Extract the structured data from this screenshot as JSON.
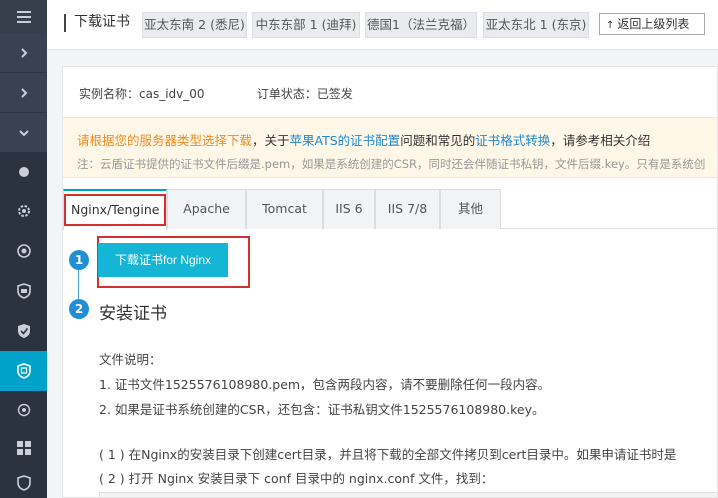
{
  "sidebar": {
    "items": [
      {
        "icon": "hamburger-icon"
      },
      {
        "icon": "chevron-right-icon"
      },
      {
        "icon": "chevron-right-icon"
      },
      {
        "icon": "chevron-down-icon"
      },
      {
        "icon": "dot-icon"
      },
      {
        "icon": "gear-icon"
      },
      {
        "icon": "eye-icon"
      },
      {
        "icon": "shield-icon"
      },
      {
        "icon": "shield-check-icon"
      },
      {
        "icon": "certificate-icon",
        "active": true
      },
      {
        "icon": "target-icon"
      },
      {
        "icon": "windows-icon"
      },
      {
        "icon": "shield-lock-icon"
      }
    ],
    "active_color": "#00a2ca"
  },
  "header": {
    "title": "下载证书",
    "regions": [
      "亚太东南 2 (悉尼)",
      "中东东部 1 (迪拜)",
      "德国1（法兰克福）",
      "亚太东北 1 (东京)"
    ],
    "back_label": "返回上级列表"
  },
  "instance": {
    "name_label": "实例名称：cas_idv_00",
    "status_label": "订单状态：已签发"
  },
  "notice": {
    "line1_a": "请根据您的服务器类型选择下载",
    "line1_b": "，关于",
    "link1": "苹果ATS的证书配置",
    "line1_c": "问题和常见的",
    "link2": "证书格式转换",
    "line1_d": "，请参考相关介绍",
    "line2": "注：云盾证书提供的证书文件后缀是.pem，如果是系统创建的CSR，同时还会伴随证书私钥，文件后缀.key。只有是系统创"
  },
  "tabs": [
    "Nginx/Tengine",
    "Apache",
    "Tomcat",
    "IIS 6",
    "IIS 7/8",
    "其他"
  ],
  "steps": {
    "step1_num": "1",
    "download_button": "下载证书for Nginx",
    "step2_num": "2",
    "step2_title": "安装证书"
  },
  "doc": {
    "heading": "文件说明：",
    "line1": "1. 证书文件1525576108980.pem，包含两段内容，请不要删除任何一段内容。",
    "line2": "2. 如果是证书系统创建的CSR，还包含：证书私钥文件1525576108980.key。",
    "line3": "( 1 ) 在Nginx的安装目录下创建cert目录，并且将下载的全部文件拷贝到cert目录中。如果申请证书时是",
    "line4": "( 2 ) 打开 Nginx 安装目录下 conf 目录中的 nginx.conf 文件，找到："
  },
  "colors": {
    "accent": "#00a2ca",
    "highlight_frame": "#d43030",
    "download_button": "#15b5d6",
    "notice_orange": "#ef8b1f",
    "link_blue": "#1e8ad1"
  }
}
